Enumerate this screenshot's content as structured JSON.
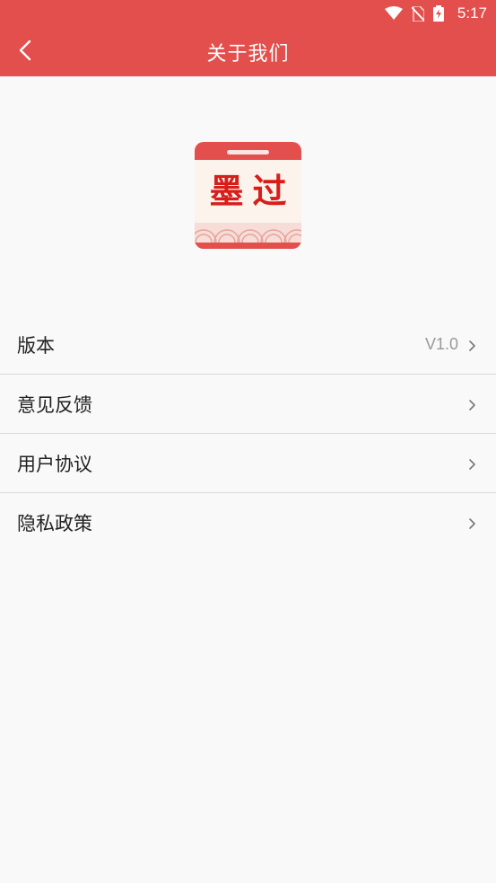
{
  "status": {
    "time": "5:17"
  },
  "header": {
    "title": "关于我们"
  },
  "logo": {
    "text": "墨过"
  },
  "menu": [
    {
      "label": "版本",
      "value": "V1.0"
    },
    {
      "label": "意见反馈"
    },
    {
      "label": "用户协议"
    },
    {
      "label": "隐私政策"
    }
  ],
  "colors": {
    "accent": "#e24f4d",
    "background": "#f9f9f9",
    "text": "#222222",
    "muted": "#999999"
  },
  "icons": {
    "back": "chevron-left-icon",
    "chevron": "chevron-right-icon",
    "wifi": "wifi-icon",
    "no_sim": "no-sim-icon",
    "battery": "battery-charging-icon"
  }
}
